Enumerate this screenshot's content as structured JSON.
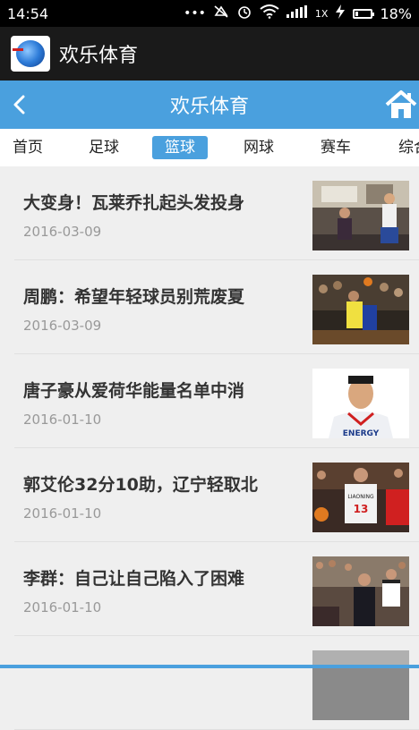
{
  "status_bar": {
    "time": "14:54",
    "icons": [
      "dots-icon",
      "mute-icon",
      "alarm-icon",
      "wifi-icon",
      "signal-icon",
      "charging-icon"
    ],
    "network": "1X",
    "battery": "18%"
  },
  "app_bar": {
    "title": "欢乐体育",
    "icon": "soccer-ball-logo-icon"
  },
  "header": {
    "title": "欢乐体育",
    "back_icon": "chevron-left-icon",
    "home_icon": "home-icon",
    "color": "#4aa0de"
  },
  "tabs": [
    {
      "label": "首页"
    },
    {
      "label": "足球"
    },
    {
      "label": "篮球",
      "active": true
    },
    {
      "label": "网球"
    },
    {
      "label": "赛车"
    },
    {
      "label": "综合"
    }
  ],
  "articles": [
    {
      "title": "大变身！瓦莱乔扎起头发投身",
      "date": "2016-03-09"
    },
    {
      "title": "周鹏：希望年轻球员别荒废夏",
      "date": "2016-03-09"
    },
    {
      "title": "唐子豪从爱荷华能量名单中消",
      "date": "2016-01-10"
    },
    {
      "title": "郭艾伦32分10助，辽宁轻取北",
      "date": "2016-01-10"
    },
    {
      "title": "李群：自己让自己陷入了困难",
      "date": "2016-01-10"
    }
  ],
  "thumb_captions": {
    "third_jersey": "ENERGY",
    "fourth_jersey": "LIAONING",
    "fourth_number": "13"
  }
}
